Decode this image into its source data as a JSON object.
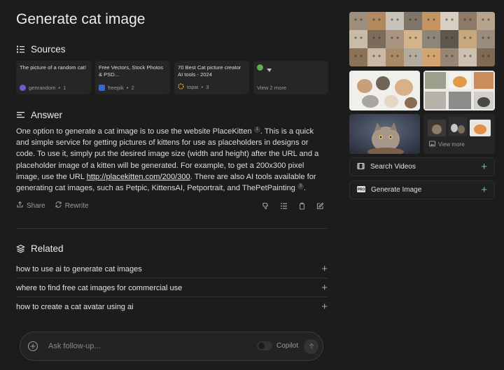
{
  "title": "Generate cat image",
  "sources": {
    "heading": "Sources",
    "items": [
      {
        "title": "The picture of a random cat!",
        "domain": "genrandom",
        "num": "1",
        "color": "#6d5bd0"
      },
      {
        "title": "Free Vectors, Stock Photos & PSD...",
        "domain": "freepik",
        "num": "2",
        "color": "#2f6bdb"
      },
      {
        "title": "70 Best Cat picture creator AI tools - 2024",
        "domain": "topai",
        "num": "3",
        "color": "#d9a520"
      }
    ],
    "more": "View 2 more"
  },
  "answer": {
    "heading": "Answer",
    "p1": "One option to generate a cat image is to use the website PlaceKitten",
    "c1": "1",
    "p2": ". This is a quick and simple service for getting pictures of kittens for use as placeholders in designs or code. To use it, simply put the desired image size (width and height) after the URL and a placeholder image of a kitten will be generated. For example, to get a 200x300 pixel image, use the URL ",
    "link": "http://placekitten.com/200/300",
    "p3": ". There are also AI tools available for generating cat images, such as Petpic, KittensAI, Petportrait, and ThePetPainting",
    "c2": "3",
    "p4": "."
  },
  "actions": {
    "share": "Share",
    "rewrite": "Rewrite"
  },
  "related": {
    "heading": "Related",
    "items": [
      "how to use ai to generate cat images",
      "where to find free cat images for commercial use",
      "how to create a cat avatar using ai"
    ]
  },
  "followup": {
    "placeholder": "Ask follow-up...",
    "copilot": "Copilot"
  },
  "sidebar": {
    "view_more": "View more",
    "search_videos": "Search Videos",
    "generate_image": "Generate Image"
  },
  "colors": {
    "accent": "#6fb8c1",
    "bg": "#1c1c1c"
  }
}
